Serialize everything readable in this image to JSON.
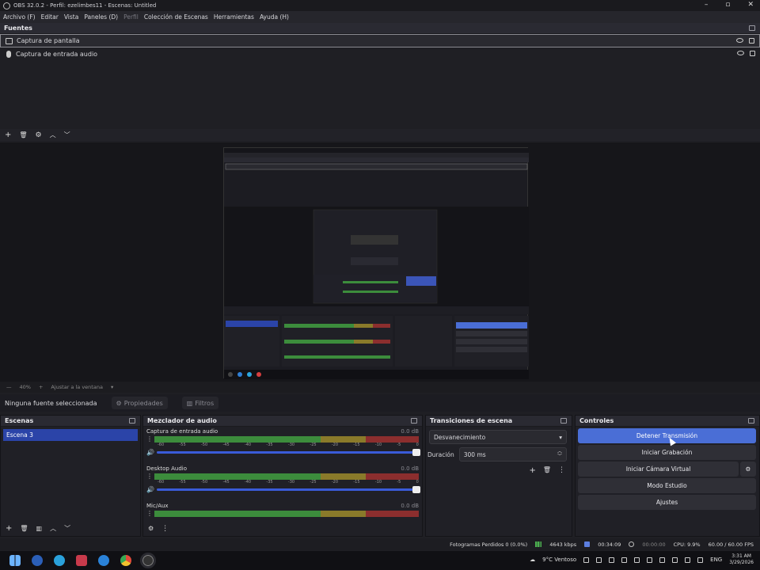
{
  "window": {
    "title": "OBS 32.0.2 - Perfil: ezelimbes11 - Escenas: Untitled"
  },
  "menu": [
    "Archivo (F)",
    "Editar",
    "Vista",
    "Paneles (D)",
    "Perfil",
    "Colección de Escenas",
    "Herramientas",
    "Ayuda (H)"
  ],
  "sources": {
    "title": "Fuentes",
    "items": [
      {
        "label": "Captura de pantalla",
        "icon": "monitor-icon"
      },
      {
        "label": "Captura de entrada audio",
        "icon": "microphone-icon"
      }
    ]
  },
  "preview": {
    "zoom": "40%",
    "fit": "Ajustar a la ventana"
  },
  "context": {
    "no_source": "Ninguna fuente seleccionada",
    "properties": "Propiedades",
    "filters": "Filtros"
  },
  "scenes": {
    "title": "Escenas",
    "items": [
      "Escena 3"
    ]
  },
  "mixer": {
    "title": "Mezclador de audio",
    "ticks": [
      "-60",
      "-55",
      "-50",
      "-45",
      "-40",
      "-35",
      "-30",
      "-25",
      "-20",
      "-15",
      "-10",
      "-5",
      "0"
    ],
    "channels": [
      {
        "name": "Captura de entrada audio",
        "db": "0.0 dB"
      },
      {
        "name": "Desktop Audio",
        "db": "0.0 dB"
      },
      {
        "name": "Mic/Aux",
        "db": "0.0 dB"
      }
    ]
  },
  "transitions": {
    "title": "Transiciones de escena",
    "selected": "Desvanecimiento",
    "duration_label": "Duración",
    "duration_value": "300 ms"
  },
  "controls": {
    "title": "Controles",
    "buttons": [
      "Detener Transmisión",
      "Iniciar Grabación",
      "Iniciar Cámara Virtual",
      "Modo Estudio",
      "Ajustes"
    ]
  },
  "status": {
    "dropped": "Fotogramas Perdidos 0 (0.0%)",
    "bitrate": "4643 kbps",
    "live_time": "00:34:09",
    "rec_time": "00:00:00",
    "cpu": "CPU: 9.9%",
    "fps": "60.00 / 60.00 FPS"
  },
  "taskbar": {
    "weather": "9°C  Ventoso",
    "lang": "ENG",
    "time": "3:31 AM",
    "date": "3/29/2026"
  },
  "colors": {
    "accent": "#4a6ed6",
    "scene_selected": "#2b44a8",
    "meter_green": "#3c8c3c",
    "meter_yellow": "#8a7a2a",
    "meter_red": "#8c2e2e"
  }
}
